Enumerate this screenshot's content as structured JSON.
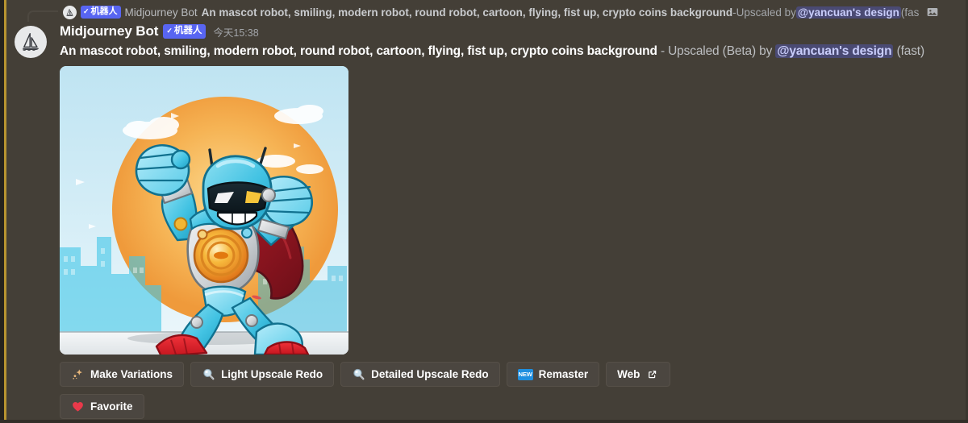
{
  "theme": {
    "background": "#443f37",
    "accent_line": "#b89430",
    "blurple": "#5865f2",
    "button_bg": "#4b4640",
    "mention_bg": "rgba(88,101,242,0.32)",
    "new_badge_bg": "#1f8fe0",
    "heart_red": "#e8394a"
  },
  "reply": {
    "avatar_icon": "midjourney-sailboat-icon",
    "bot_badge": {
      "check": "✓",
      "label": "机器人"
    },
    "author": "Midjourney Bot",
    "prompt": "An mascot robot, smiling, modern robot, round robot, cartoon, flying, fist up, crypto coins background",
    "separator": " - ",
    "action": "Upscaled by ",
    "mention": "@yancuan's design",
    "speed": " (fast)",
    "attachment_icon": "image-attachment-icon"
  },
  "message": {
    "avatar_icon": "midjourney-sailboat-icon",
    "author": "Midjourney Bot",
    "bot_badge": {
      "check": "✓",
      "label": "机器人"
    },
    "timestamp": "今天15:38",
    "prompt": "An mascot robot, smiling, modern robot, round robot, cartoon, flying, fist up, crypto coins background",
    "separator": " - ",
    "action": "Upscaled (Beta) by ",
    "mention": "@yancuan's design",
    "speed": " (fast)"
  },
  "image": {
    "alt": "Cartoon mascot robot superhero with cyan body, red cape and boots, fist raised, orange sun and blue city skyline background"
  },
  "buttons": {
    "row1": [
      {
        "label": "Make Variations",
        "icon": "sparkles-icon"
      },
      {
        "label": "Light Upscale Redo",
        "icon": "magnifying-glass-icon"
      },
      {
        "label": "Detailed Upscale Redo",
        "icon": "magnifying-glass-icon"
      },
      {
        "label": "Remaster",
        "icon": "new-badge-icon",
        "badge": "NEW"
      },
      {
        "label": "Web",
        "icon": "external-link-icon"
      }
    ],
    "row2": [
      {
        "label": "Favorite",
        "icon": "heart-icon"
      }
    ]
  }
}
